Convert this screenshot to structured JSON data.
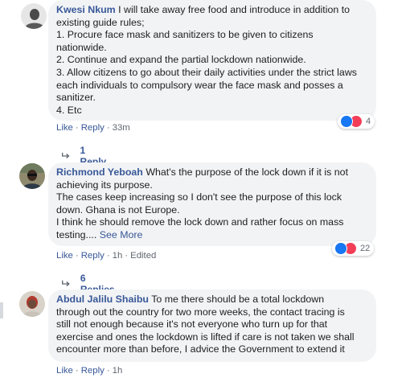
{
  "comments": [
    {
      "author": "Kwesi Nkum",
      "lines": [
        "I will take away free food and introduce in addition to",
        "existing guide rules;",
        "1. Procure face mask and sanitizers to be given to citizens",
        "nationwide.",
        "2. Continue and expand the partial lockdown nationwide.",
        "3. Allow citizens to go about their daily activities under the strict laws",
        "each individuals to compulsory wear the face mask and posses a",
        "sanitizer.",
        "4. Etc"
      ],
      "like_label": "Like",
      "reply_label": "Reply",
      "time": "33m",
      "reaction_count": "4",
      "replies_label": "1 Reply"
    },
    {
      "author": "Richmond Yeboah",
      "lines": [
        "What's the purpose of the lock down if it is not",
        "achieving its purpose.",
        "The cases keep increasing so I don't see the purpose of this lock",
        "down. Ghana is not Europe.",
        "I think he should remove the lock down and rather focus on mass",
        "testing...."
      ],
      "see_more": "See More",
      "like_label": "Like",
      "reply_label": "Reply",
      "time": "1h",
      "edited": "Edited",
      "reaction_count": "22",
      "replies_label": "6 Replies"
    },
    {
      "author": "Abdul Jalilu Shaibu",
      "lines": [
        "To me there should be a total lockdown",
        "through out the country for two more weeks, the contact tracing is",
        "still not enough because it's not everyone who turn up for that",
        "exercise and ones the lockdown is lifted if care is not taken we shall",
        "encounter more than before, I advice the Government to extend it"
      ],
      "like_label": "Like",
      "reply_label": "Reply",
      "time": "1h"
    }
  ],
  "colors": {
    "link": "#385898",
    "bubble": "#f2f3f5",
    "like": "#1877f2",
    "love": "#f33e58",
    "meta": "#606770"
  }
}
